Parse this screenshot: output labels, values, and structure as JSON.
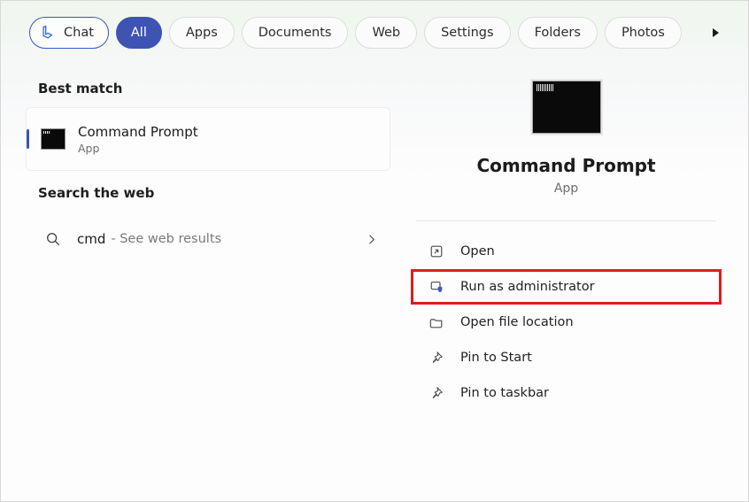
{
  "filters": {
    "chat": "Chat",
    "all": "All",
    "apps": "Apps",
    "documents": "Documents",
    "web": "Web",
    "settings": "Settings",
    "folders": "Folders",
    "photos": "Photos"
  },
  "sections": {
    "best_match": "Best match",
    "search_web": "Search the web"
  },
  "best_match_item": {
    "title": "Command Prompt",
    "subtitle": "App"
  },
  "web_result": {
    "query": "cmd",
    "suffix": " - See web results"
  },
  "detail": {
    "title": "Command Prompt",
    "subtitle": "App"
  },
  "actions": {
    "open": "Open",
    "run_admin": "Run as administrator",
    "open_location": "Open file location",
    "pin_start": "Pin to Start",
    "pin_taskbar": "Pin to taskbar"
  }
}
